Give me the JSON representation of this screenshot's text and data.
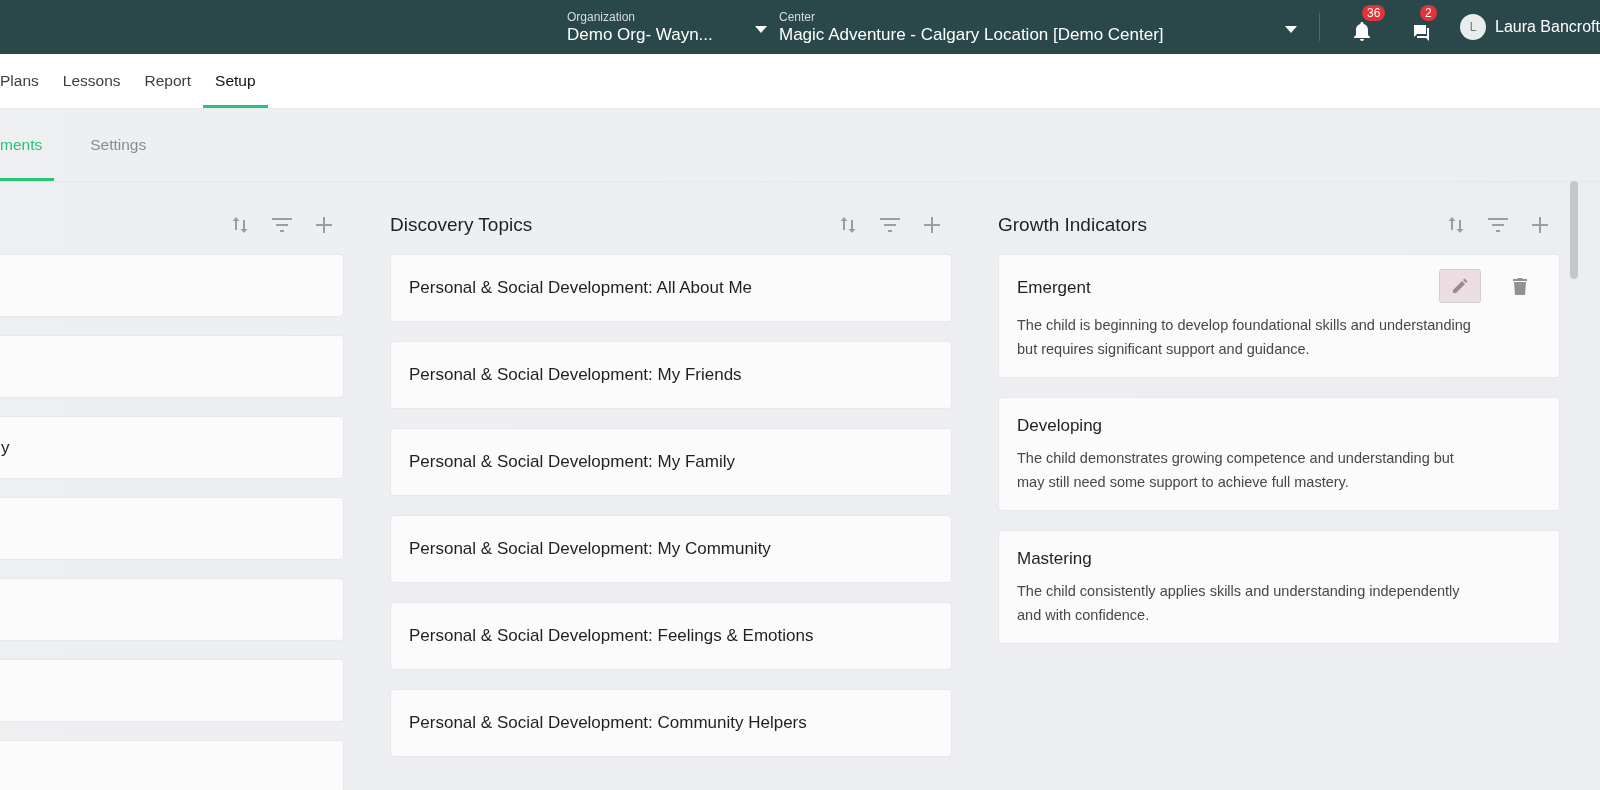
{
  "top_bar": {
    "organization": {
      "label": "Organization",
      "value": "Demo Org- Wayn..."
    },
    "center": {
      "label": "Center",
      "value": "Magic Adventure - Calgary Location [Demo Center]"
    },
    "notifications": {
      "count": "36"
    },
    "messages": {
      "count": "2"
    },
    "user": {
      "initial": "L",
      "name": "Laura Bancroft"
    }
  },
  "nav_tabs": [
    {
      "label": "Plans",
      "selected": false
    },
    {
      "label": "Lessons",
      "selected": false
    },
    {
      "label": "Report",
      "selected": false
    },
    {
      "label": "Setup",
      "selected": true
    }
  ],
  "sub_tabs": [
    {
      "label": "ments",
      "selected": true
    },
    {
      "label": "Settings",
      "selected": false
    }
  ],
  "columns": [
    {
      "cards": [
        {
          "kind": "blank"
        },
        {
          "kind": "blank"
        },
        {
          "kind": "text",
          "title": "y"
        },
        {
          "kind": "blank"
        },
        {
          "kind": "blank"
        },
        {
          "kind": "blank"
        },
        {
          "kind": "blank"
        }
      ]
    },
    {
      "title": "Discovery Topics",
      "cards": [
        {
          "title": "Personal & Social Development: All About Me"
        },
        {
          "title": "Personal & Social Development: My Friends"
        },
        {
          "title": "Personal & Social Development: My Family"
        },
        {
          "title": "Personal & Social Development: My Community"
        },
        {
          "title": "Personal & Social Development: Feelings & Emotions"
        },
        {
          "title": "Personal & Social Development: Community Helpers"
        }
      ]
    },
    {
      "title": "Growth Indicators",
      "cards": [
        {
          "title": "Emergent",
          "description": "The child is beginning to develop foundational skills and understanding but requires significant support and guidance.",
          "hovered": true
        },
        {
          "title": "Developing",
          "description": "The child demonstrates growing competence and understanding but may still need some support to achieve full mastery.",
          "hovered": false
        },
        {
          "title": "Mastering",
          "description": "The child consistently applies skills and understanding independently and with confidence.",
          "hovered": false
        }
      ]
    }
  ]
}
